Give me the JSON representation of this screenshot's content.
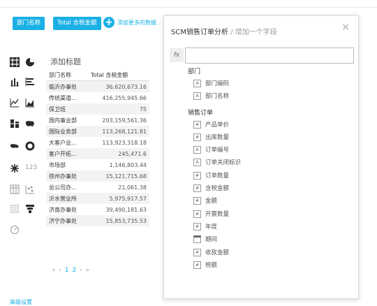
{
  "top": {
    "chips": [
      "部门名称",
      "Total 含税金额"
    ],
    "add_label": "添加更多的数据 ."
  },
  "left_icons": [
    "table-icon",
    "pie-chart-icon",
    "bar-chart-icon",
    "horizontal-bar-icon",
    "line-chart-icon",
    "area-chart-icon",
    "stacked-bar-icon",
    "us-map-icon",
    "map-icon",
    "donut-icon",
    "sunburst-icon",
    "kpi-number-icon",
    "pivot-table-icon",
    "scatter-icon",
    "heatmap-icon",
    "funnel-icon",
    "gauge-icon"
  ],
  "left_icon_text": {
    "kpi": "123"
  },
  "card": {
    "title": "添加标题",
    "columns": [
      "部门名称",
      "Total 含税金额"
    ],
    "rows": [
      [
        "临沂办事处",
        "36,620,673.16"
      ],
      [
        "传统渠道...",
        "416,255,945.66"
      ],
      [
        "保卫班",
        "75"
      ],
      [
        "国内事业部",
        "203,159,561.36"
      ],
      [
        "国际业务部",
        "113,268,121.81"
      ],
      [
        "大客户业...",
        "113,923,318.18"
      ],
      [
        "客户开拓...",
        "245,471.6"
      ],
      [
        "市场部",
        "1,146,803.44"
      ],
      [
        "徐州办事处",
        "15,121,715.68"
      ],
      [
        "总公司办...",
        "21,061.38"
      ],
      [
        "沂水营业所",
        "5,975,917.57"
      ],
      [
        "济南办事处",
        "39,490,181.63"
      ],
      [
        "济宁办事处",
        "15,853,735.53"
      ]
    ],
    "pager": {
      "first": "«",
      "prev": "‹",
      "page1": "1",
      "page2": "2",
      "next": "›",
      "last": "»"
    }
  },
  "bottom_text": "高级设置",
  "panel": {
    "title": "SCM销售订单分析",
    "subtitle": " / 增加一个字段",
    "close": "×",
    "fx": "fx",
    "input_value": "",
    "groups": [
      {
        "name": "部门",
        "fields": [
          {
            "type": "A",
            "label": "部门编码"
          },
          {
            "type": "A",
            "label": "部门名称"
          }
        ]
      },
      {
        "name": "销售订单",
        "fields": [
          {
            "type": "#",
            "label": "产品单价"
          },
          {
            "type": "#",
            "label": "出库数量"
          },
          {
            "type": "A",
            "label": "订单编号"
          },
          {
            "type": "A",
            "label": "订单关闭标识"
          },
          {
            "type": "#",
            "label": "订单数量"
          },
          {
            "type": "#",
            "label": "含税金额"
          },
          {
            "type": "#",
            "label": "金额"
          },
          {
            "type": "#",
            "label": "开票数量"
          },
          {
            "type": "#",
            "label": "年度"
          },
          {
            "type": "date",
            "label": "期间"
          },
          {
            "type": "#",
            "label": "收款金额"
          },
          {
            "type": "#",
            "label": "税额"
          }
        ]
      }
    ]
  },
  "colors": {
    "accent": "#1ab0e6",
    "icon": "#2a2a2a"
  }
}
